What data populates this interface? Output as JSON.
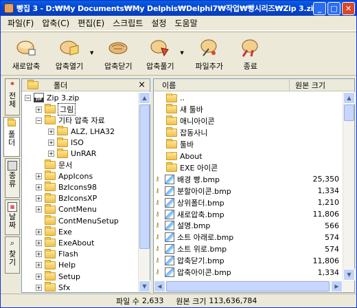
{
  "window": {
    "title": "빵집 3 - D:₩My Documents₩My Delphis₩Delphi7₩작업₩빵시리즈₩Zip 3.zip"
  },
  "menu": [
    "파일(F)",
    "압축(C)",
    "편집(E)",
    "스크립트",
    "설정",
    "도움말"
  ],
  "toolbar": [
    {
      "label": "새로압축",
      "icon": "new-archive-icon",
      "dropdown": false
    },
    {
      "label": "압축열기",
      "icon": "open-archive-icon",
      "dropdown": true
    },
    {
      "label": "압축닫기",
      "icon": "close-archive-icon",
      "dropdown": false
    },
    {
      "label": "압축풀기",
      "icon": "extract-icon",
      "dropdown": true
    },
    {
      "label": "파일추가",
      "icon": "add-file-icon",
      "dropdown": false
    },
    {
      "label": "종료",
      "icon": "exit-icon",
      "dropdown": false
    }
  ],
  "side_tabs": [
    "전체",
    "폴더",
    "종류",
    "날짜",
    "찾기"
  ],
  "folder_panel": {
    "header": "폴더",
    "close": "×",
    "root": "Zip 3.zip",
    "zip_badge": "ZIP",
    "tree": [
      {
        "label": "그림",
        "level": 1,
        "expander": "+",
        "selected": true
      },
      {
        "label": "기타 압축 자료",
        "level": 1,
        "expander": "−"
      },
      {
        "label": "ALZ, LHA32",
        "level": 2,
        "expander": "+"
      },
      {
        "label": "ISO",
        "level": 2,
        "expander": "+"
      },
      {
        "label": "UnRAR",
        "level": 2,
        "expander": "+"
      },
      {
        "label": "문서",
        "level": 1,
        "expander": ""
      },
      {
        "label": "AppIcons",
        "level": 1,
        "expander": "+"
      },
      {
        "label": "BzIcons98",
        "level": 1,
        "expander": "+"
      },
      {
        "label": "BzIconsXP",
        "level": 1,
        "expander": "+"
      },
      {
        "label": "ContMenu",
        "level": 1,
        "expander": "+"
      },
      {
        "label": "ContMenuSetup",
        "level": 1,
        "expander": ""
      },
      {
        "label": "Exe",
        "level": 1,
        "expander": "+"
      },
      {
        "label": "ExeAbout",
        "level": 1,
        "expander": "+"
      },
      {
        "label": "Flash",
        "level": 1,
        "expander": "+"
      },
      {
        "label": "Help",
        "level": 1,
        "expander": "+"
      },
      {
        "label": "Setup",
        "level": 1,
        "expander": "+"
      },
      {
        "label": "Sfx",
        "level": 1,
        "expander": "+"
      }
    ]
  },
  "file_panel": {
    "columns": [
      "이름",
      "원본 크기"
    ],
    "rows": [
      {
        "name": "..",
        "size": "",
        "type": "folder"
      },
      {
        "name": "새 툴바",
        "size": "",
        "type": "folder"
      },
      {
        "name": "애니아이콘",
        "size": "",
        "type": "folder"
      },
      {
        "name": "잡동사니",
        "size": "",
        "type": "folder"
      },
      {
        "name": "툴바",
        "size": "",
        "type": "folder"
      },
      {
        "name": "About",
        "size": "",
        "type": "folder"
      },
      {
        "name": "EXE 아이콘",
        "size": "",
        "type": "folder"
      },
      {
        "name": "배경 빵.bmp",
        "size": "25,350",
        "type": "file"
      },
      {
        "name": "분할아이콘.bmp",
        "size": "1,334",
        "type": "file"
      },
      {
        "name": "상위폴더.bmp",
        "size": "1,210",
        "type": "file"
      },
      {
        "name": "새로압축.bmp",
        "size": "11,806",
        "type": "file"
      },
      {
        "name": "설명.bmp",
        "size": "566",
        "type": "file"
      },
      {
        "name": "소트 아래로.bmp",
        "size": "574",
        "type": "file"
      },
      {
        "name": "소트 위로.bmp",
        "size": "574",
        "type": "file"
      },
      {
        "name": "압축닫기.bmp",
        "size": "11,806",
        "type": "file"
      },
      {
        "name": "압축아이콘.bmp",
        "size": "1,334",
        "type": "file"
      }
    ]
  },
  "status": {
    "files_label": "파일 수",
    "files": "2,633",
    "size_label": "원본 크기",
    "size": "113,636,784"
  }
}
